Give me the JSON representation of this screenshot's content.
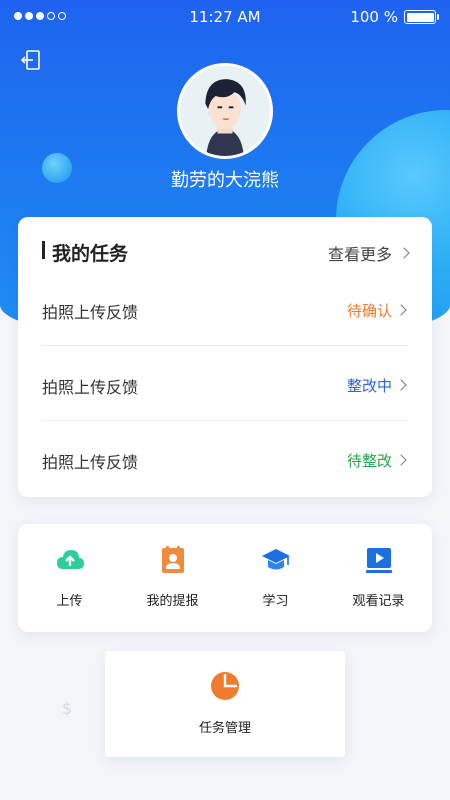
{
  "status_bar": {
    "time": "11:27 AM",
    "battery": "100 %",
    "battery_level": 1.0
  },
  "profile": {
    "nickname": "勤劳的大浣熊",
    "avatar": "avatar-illustration"
  },
  "icons": {
    "logout": "logout-icon",
    "upload": "cloud-upload-icon",
    "reports": "contact-card-icon",
    "study": "graduation-cap-icon",
    "watch": "video-play-icon",
    "manage": "pie-chart-icon"
  },
  "tasks": {
    "title": "我的任务",
    "more": "查看更多",
    "items": [
      {
        "name": "拍照上传反馈",
        "status": "待确认",
        "color": "#f07b2c"
      },
      {
        "name": "拍照上传反馈",
        "status": "整改中",
        "color": "#2d66d8"
      },
      {
        "name": "拍照上传反馈",
        "status": "待整改",
        "color": "#29a348"
      }
    ]
  },
  "menu": {
    "items": [
      {
        "label": "上传"
      },
      {
        "label": "我的提报"
      },
      {
        "label": "学习"
      },
      {
        "label": "观看记录"
      }
    ]
  },
  "manage": {
    "label": "任务管理"
  },
  "colors": {
    "primary": "#1e63f0",
    "orange": "#f07b2c",
    "teal": "#2bcf9c",
    "blue_icon": "#1b6fe0"
  }
}
